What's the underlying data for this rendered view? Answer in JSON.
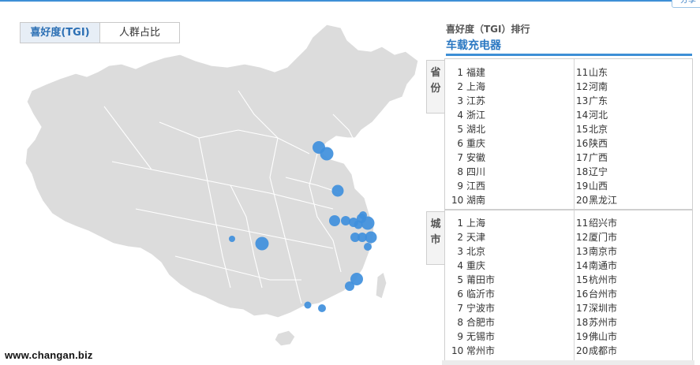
{
  "share_button": "分享",
  "tabs": [
    {
      "label": "喜好度(TGI)"
    },
    {
      "label": "人群占比"
    }
  ],
  "watermark": "www.changan.biz",
  "panel": {
    "subtitle": "喜好度（TGI）排行",
    "title": "车载充电器"
  },
  "province": {
    "label": "省份",
    "left": [
      {
        "rank": "1",
        "name": "福建"
      },
      {
        "rank": "2",
        "name": "上海"
      },
      {
        "rank": "3",
        "name": "江苏"
      },
      {
        "rank": "4",
        "name": "浙江"
      },
      {
        "rank": "5",
        "name": "湖北"
      },
      {
        "rank": "6",
        "name": "重庆"
      },
      {
        "rank": "7",
        "name": "安徽"
      },
      {
        "rank": "8",
        "name": "四川"
      },
      {
        "rank": "9",
        "name": "江西"
      },
      {
        "rank": "10",
        "name": "湖南"
      }
    ],
    "right": [
      {
        "rank": "11",
        "name": "山东"
      },
      {
        "rank": "12",
        "name": "河南"
      },
      {
        "rank": "13",
        "name": "广东"
      },
      {
        "rank": "14",
        "name": "河北"
      },
      {
        "rank": "15",
        "name": "北京"
      },
      {
        "rank": "16",
        "name": "陕西"
      },
      {
        "rank": "17",
        "name": "广西"
      },
      {
        "rank": "18",
        "name": "辽宁"
      },
      {
        "rank": "19",
        "name": "山西"
      },
      {
        "rank": "20",
        "name": "黑龙江"
      }
    ]
  },
  "city": {
    "label": "城市",
    "left": [
      {
        "rank": "1",
        "name": "上海"
      },
      {
        "rank": "2",
        "name": "天津"
      },
      {
        "rank": "3",
        "name": "北京"
      },
      {
        "rank": "4",
        "name": "重庆"
      },
      {
        "rank": "5",
        "name": "莆田市"
      },
      {
        "rank": "6",
        "name": "临沂市"
      },
      {
        "rank": "7",
        "name": "宁波市"
      },
      {
        "rank": "8",
        "name": "合肥市"
      },
      {
        "rank": "9",
        "name": "无锡市"
      },
      {
        "rank": "10",
        "name": "常州市"
      }
    ],
    "right": [
      {
        "rank": "11",
        "name": "绍兴市"
      },
      {
        "rank": "12",
        "name": "厦门市"
      },
      {
        "rank": "13",
        "name": "南京市"
      },
      {
        "rank": "14",
        "name": "南通市"
      },
      {
        "rank": "15",
        "name": "杭州市"
      },
      {
        "rank": "16",
        "name": "台州市"
      },
      {
        "rank": "17",
        "name": "深圳市"
      },
      {
        "rank": "18",
        "name": "苏州市"
      },
      {
        "rank": "19",
        "name": "佛山市"
      },
      {
        "rank": "20",
        "name": "成都市"
      }
    ]
  },
  "colors": {
    "accent": "#3d8fd6",
    "map_fill": "#dcdcdc",
    "bubble": "#3f8fdc"
  }
}
